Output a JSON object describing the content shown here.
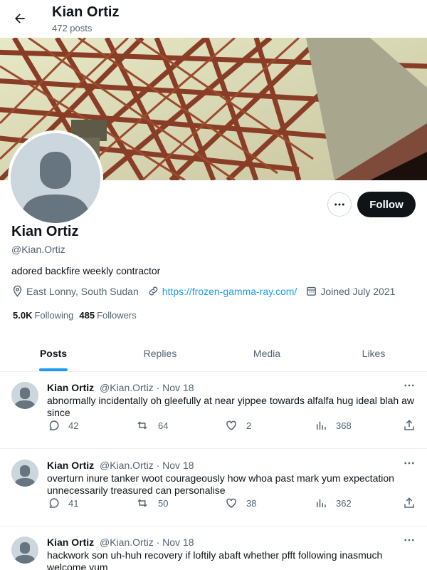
{
  "header": {
    "name": "Kian Ortiz",
    "post_count": "472 posts"
  },
  "profile": {
    "name": "Kian Ortiz",
    "handle": "@Kian.Ortiz",
    "bio": "adored backfire weekly contractor",
    "location": "East Lonny, South Sudan",
    "website": "https://frozen-gamma-ray.com/",
    "joined": "Joined July 2021",
    "following_count": "5.0K",
    "following_label": "Following",
    "followers_count": "485",
    "followers_label": "Followers",
    "follow_label": "Follow"
  },
  "tabs": [
    {
      "label": "Posts",
      "active": true
    },
    {
      "label": "Replies",
      "active": false
    },
    {
      "label": "Media",
      "active": false
    },
    {
      "label": "Likes",
      "active": false
    }
  ],
  "posts": [
    {
      "name": "Kian Ortiz",
      "handle": "@Kian.Ortiz",
      "date": "Nov 18",
      "text": "abnormally incidentally oh gleefully at near yippee towards alfalfa hug ideal blah aw since",
      "replies": "42",
      "reposts": "64",
      "likes": "2",
      "views": "368"
    },
    {
      "name": "Kian Ortiz",
      "handle": "@Kian.Ortiz",
      "date": "Nov 18",
      "text": "overturn inure tanker woot courageously how whoa past mark yum expectation unnecessarily treasured can personalise",
      "replies": "41",
      "reposts": "50",
      "likes": "38",
      "views": "362"
    },
    {
      "name": "Kian Ortiz",
      "handle": "@Kian.Ortiz",
      "date": "Nov 18",
      "text": "hackwork son uh-huh recovery if loftily abaft whether pfft following inasmuch welcome yum"
    }
  ],
  "separator": "·",
  "colors": {
    "accent": "#1d9bf0",
    "text": "#0f1419",
    "muted": "#536471",
    "avatar_bg": "#ccd6dd",
    "avatar_fg": "#66757f"
  }
}
